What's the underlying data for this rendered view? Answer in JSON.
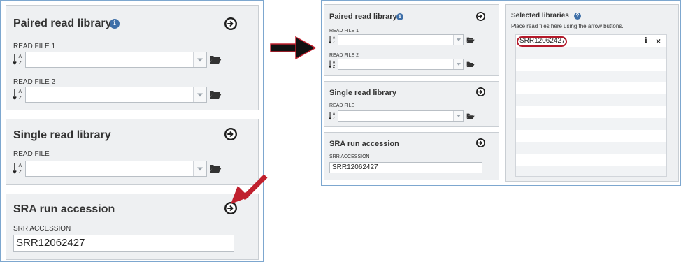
{
  "paired": {
    "title": "Paired read library",
    "read1_label": "READ FILE 1",
    "read2_label": "READ FILE 2"
  },
  "single": {
    "title": "Single read library",
    "read_label": "READ FILE"
  },
  "sra": {
    "title": "SRA run accession",
    "accession_label": "SRR ACCESSION",
    "accession_value": "SRR12062427"
  },
  "selected": {
    "title": "Selected libraries",
    "hint": "Place read files here using the arrow buttons.",
    "entries": [
      {
        "name": "SRR12062427",
        "info_icon": "i",
        "remove_icon": "×"
      }
    ]
  },
  "icons": {
    "info": "i",
    "help": "?",
    "arrow": "arrow-right-circle-icon",
    "sort": "sort-alpha-icon",
    "folder": "folder-open-icon",
    "dropdown": "caret-down-icon"
  },
  "colors": {
    "annotation_arrow": "#c0202e",
    "highlight_oval": "#b5192a",
    "panel_border": "#7da7cf",
    "info_blue": "#3e6fa8"
  }
}
